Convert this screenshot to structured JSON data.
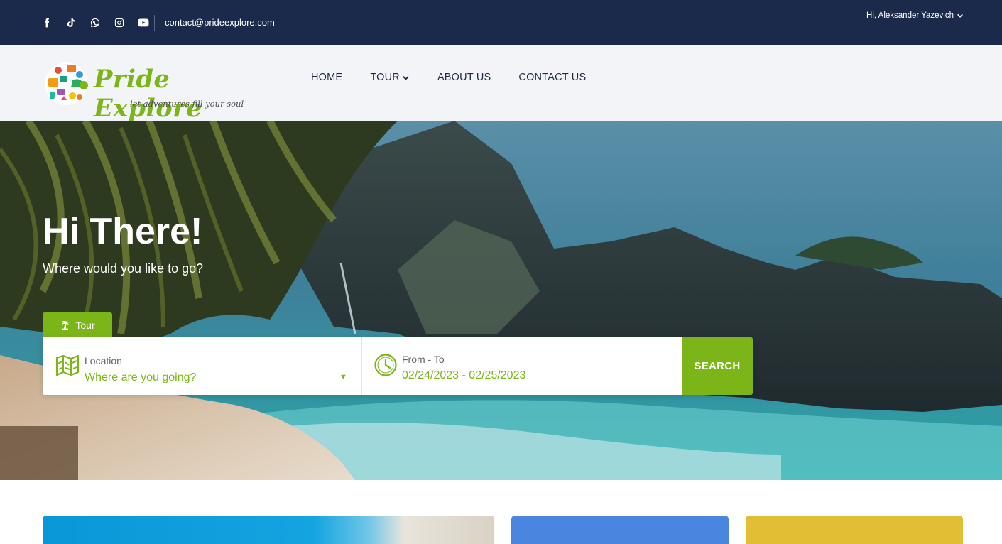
{
  "topbar": {
    "social_icons": [
      "facebook-icon",
      "tiktok-icon",
      "whatsapp-icon",
      "instagram-icon",
      "youtube-icon"
    ],
    "email": "contact@prideexplore.com",
    "user_greeting": "Hi, Aleksander Yazevich"
  },
  "brand": {
    "name": "Pride Explore",
    "tagline": "let adventures fill your soul",
    "color": "#7cb518"
  },
  "nav": {
    "items": [
      {
        "label": "HOME"
      },
      {
        "label": "TOUR"
      },
      {
        "label": "ABOUT US"
      },
      {
        "label": "CONTACT US"
      }
    ]
  },
  "hero": {
    "title": "Hi There!",
    "subtitle": "Where would you like to go?"
  },
  "search": {
    "tab_label": "Tour",
    "location_label": "Location",
    "location_placeholder": "Where are you going?",
    "date_label": "From - To",
    "date_value": "02/24/2023 - 02/25/2023",
    "button_label": "SEARCH"
  },
  "colors": {
    "topbar": "#1b2a4a",
    "accent": "#7cb518",
    "card_blue": "#4a86e0",
    "card_yellow": "#e1be33"
  }
}
